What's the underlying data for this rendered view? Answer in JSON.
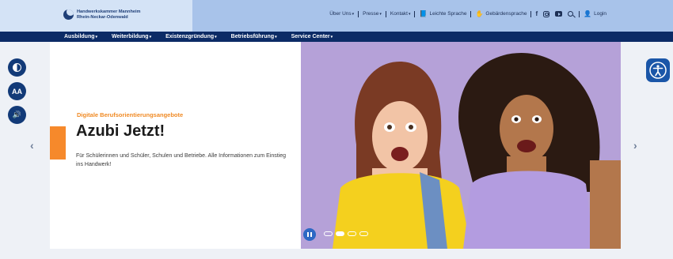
{
  "header": {
    "logo_line1": "Handwerkskammer Mannheim",
    "logo_line2": "Rhein-Neckar-Odenwald",
    "util_links": [
      {
        "label": "Über Uns"
      },
      {
        "label": "Presse"
      },
      {
        "label": "Kontakt"
      }
    ],
    "leichte_sprache": "Leichte Sprache",
    "gebaerdensprache": "Gebärdensprache",
    "login": "Login",
    "social_icons": [
      "facebook-icon",
      "instagram-icon",
      "youtube-icon"
    ]
  },
  "nav": {
    "items": [
      {
        "label": "Ausbildung"
      },
      {
        "label": "Weiterbildung"
      },
      {
        "label": "Existenzgründung"
      },
      {
        "label": "Betriebsführung"
      },
      {
        "label": "Service Center"
      }
    ]
  },
  "hero": {
    "eyebrow": "Digitale Berufsorientierungsangebote",
    "title": "Azubi Jetzt!",
    "description": "Für Schülerinnen und Schüler, Schulen und Betriebe. Alle Informationen zum Einstieg ins Handwerk!",
    "slide_count": 4,
    "active_slide": 1
  },
  "a11y_buttons": {
    "contrast_icon": "contrast-icon",
    "font_size_label": "AA",
    "sound_icon": "speaker-icon"
  },
  "colors": {
    "nav_bg": "#0c2b66",
    "topbar_bg": "#a8c3ea",
    "accent_orange": "#f6892b",
    "a11y_blue": "#1a56a8"
  }
}
